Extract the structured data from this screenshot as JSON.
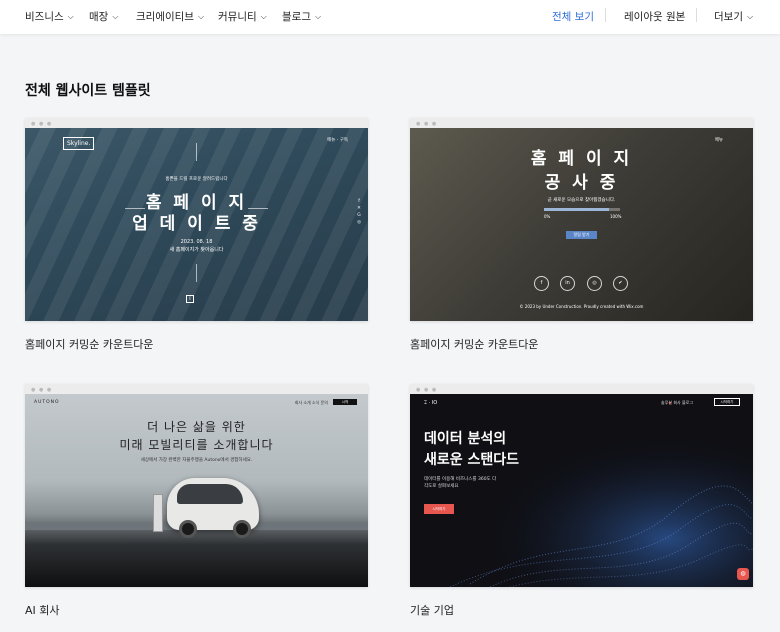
{
  "nav": {
    "items": [
      {
        "label": "비즈니스"
      },
      {
        "label": "매장"
      },
      {
        "label": "크리에이티브"
      },
      {
        "label": "커뮤니티"
      },
      {
        "label": "블로그"
      }
    ],
    "right": {
      "view_all": "전체 보기",
      "layout_original": "레이아웃 원본",
      "more": "더보기"
    }
  },
  "colors": {
    "accent": "#2f6fd8",
    "background": "#f4f5f7"
  },
  "section": {
    "title": "전체 웹사이트 템플릿"
  },
  "cards": [
    {
      "label": "홈페이지 커밍순 카운트다운",
      "preview": {
        "logo": "Skyline.",
        "top_links": "메뉴 · 구독",
        "small_top": "홈쁜을 드릴 프로운 알려드립니다",
        "line1": "홈 페 이 지",
        "line2": "업 데 이 트 중",
        "date": "2023. 08. 18",
        "date_sub": "새 홈페이지가 찾아옵니다",
        "info": "i"
      }
    },
    {
      "label": "홈페이지 커밍순 카운트다운",
      "preview": {
        "top_link": "메뉴",
        "line1": "홈 페 이 지",
        "line2": "공 사 중",
        "sub": "곧 새로운 모습으로 찾아뵙겠습니다.",
        "progress": 0.85,
        "pct_left": "0%",
        "pct_right": "100%",
        "button": "알림 받기",
        "footer": "© 2023 by Under Construction. Proudly created with Wix.com"
      }
    },
    {
      "label": "AI 회사",
      "preview": {
        "brand": "AUTONO",
        "menu": "회사 소개   소식   문의",
        "button": "시작",
        "line1": "더 나은 삶을 위한",
        "line2": "미래 모빌리티를 소개합니다",
        "sub": "세상에서 가장 완벽한 자율주행을 Autono에서 경험하세요."
      }
    },
    {
      "label": "기술 기업",
      "preview": {
        "logo": "⌶ · IO",
        "nav": "솔루션   회사   블로그",
        "outline_button": "시작하기",
        "line1": "데이터 분석의",
        "line2": "새로운 스탠다드",
        "sub1": "데이터를 이용해 비즈니스를 360도 다",
        "sub2": "각도로 살펴보세요",
        "button": "시작하기"
      }
    }
  ]
}
